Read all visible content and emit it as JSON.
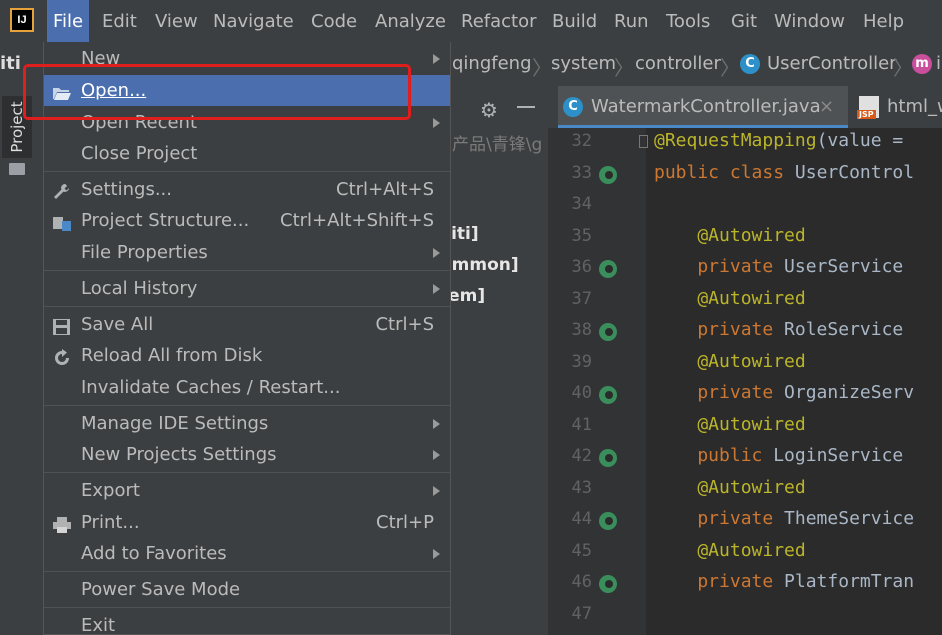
{
  "menubar": {
    "items": [
      "File",
      "Edit",
      "View",
      "Navigate",
      "Code",
      "Analyze",
      "Refactor",
      "Build",
      "Run",
      "Tools",
      "Git",
      "Window",
      "Help"
    ]
  },
  "navbar": {
    "crumb_left": "iti",
    "crumbs": [
      "qingfeng",
      "system",
      "controller",
      "UserController"
    ],
    "trailing": "i"
  },
  "toolwindow": {
    "project_label": "Project"
  },
  "project_panel": {
    "path": "产品\\青锋\\g",
    "rows": [
      "viti]",
      "ommon]",
      "tem]"
    ]
  },
  "editor": {
    "tabs": [
      "WatermarkController.java",
      "html_w"
    ],
    "tab_close": "×",
    "tab2_badge": "JSP",
    "lines": [
      {
        "n": "32",
        "segs": [
          {
            "t": "@RequestMapping",
            "c": "ann"
          },
          {
            "t": "(value = ",
            "c": "plain"
          }
        ]
      },
      {
        "n": "33",
        "segs": [
          {
            "t": "public class ",
            "c": "kw"
          },
          {
            "t": "UserControl",
            "c": "plain"
          }
        ]
      },
      {
        "n": "34",
        "segs": []
      },
      {
        "n": "35",
        "segs": [
          {
            "t": "    @Autowired",
            "c": "ann"
          }
        ]
      },
      {
        "n": "36",
        "segs": [
          {
            "t": "    private ",
            "c": "kw"
          },
          {
            "t": "UserService",
            "c": "plain"
          }
        ]
      },
      {
        "n": "37",
        "segs": [
          {
            "t": "    @Autowired",
            "c": "ann"
          }
        ]
      },
      {
        "n": "38",
        "segs": [
          {
            "t": "    private ",
            "c": "kw"
          },
          {
            "t": "RoleService",
            "c": "plain"
          }
        ]
      },
      {
        "n": "39",
        "segs": [
          {
            "t": "    @Autowired",
            "c": "ann"
          }
        ]
      },
      {
        "n": "40",
        "segs": [
          {
            "t": "    private ",
            "c": "kw"
          },
          {
            "t": "OrganizeServ",
            "c": "plain"
          }
        ]
      },
      {
        "n": "41",
        "segs": [
          {
            "t": "    @Autowired",
            "c": "ann"
          }
        ]
      },
      {
        "n": "42",
        "segs": [
          {
            "t": "    public ",
            "c": "kw"
          },
          {
            "t": "LoginService",
            "c": "plain"
          }
        ]
      },
      {
        "n": "43",
        "segs": [
          {
            "t": "    @Autowired",
            "c": "ann"
          }
        ]
      },
      {
        "n": "44",
        "segs": [
          {
            "t": "    private ",
            "c": "kw"
          },
          {
            "t": "ThemeService",
            "c": "plain"
          }
        ]
      },
      {
        "n": "45",
        "segs": [
          {
            "t": "    @Autowired",
            "c": "ann"
          }
        ]
      },
      {
        "n": "46",
        "segs": [
          {
            "t": "    private ",
            "c": "kw"
          },
          {
            "t": "PlatformTran",
            "c": "plain"
          }
        ]
      },
      {
        "n": "47",
        "segs": []
      }
    ]
  },
  "file_menu": {
    "new": "New",
    "open": "Open...",
    "open_recent": "Open Recent",
    "close_project": "Close Project",
    "settings": "Settings...",
    "settings_sc": "Ctrl+Alt+S",
    "project_structure": "Project Structure...",
    "project_structure_sc": "Ctrl+Alt+Shift+S",
    "file_properties": "File Properties",
    "local_history": "Local History",
    "save_all": "Save All",
    "save_all_sc": "Ctrl+S",
    "reload": "Reload All from Disk",
    "invalidate": "Invalidate Caches / Restart...",
    "manage_ide": "Manage IDE Settings",
    "new_projects_settings": "New Projects Settings",
    "export": "Export",
    "print": "Print...",
    "print_sc": "Ctrl+P",
    "add_favorites": "Add to Favorites",
    "power_save": "Power Save Mode",
    "exit": "Exit"
  },
  "colors": {
    "accent": "#4b6eaf",
    "highlight_box": "#e01e1e",
    "keyword": "#cc7832",
    "annotation": "#bbb529"
  }
}
